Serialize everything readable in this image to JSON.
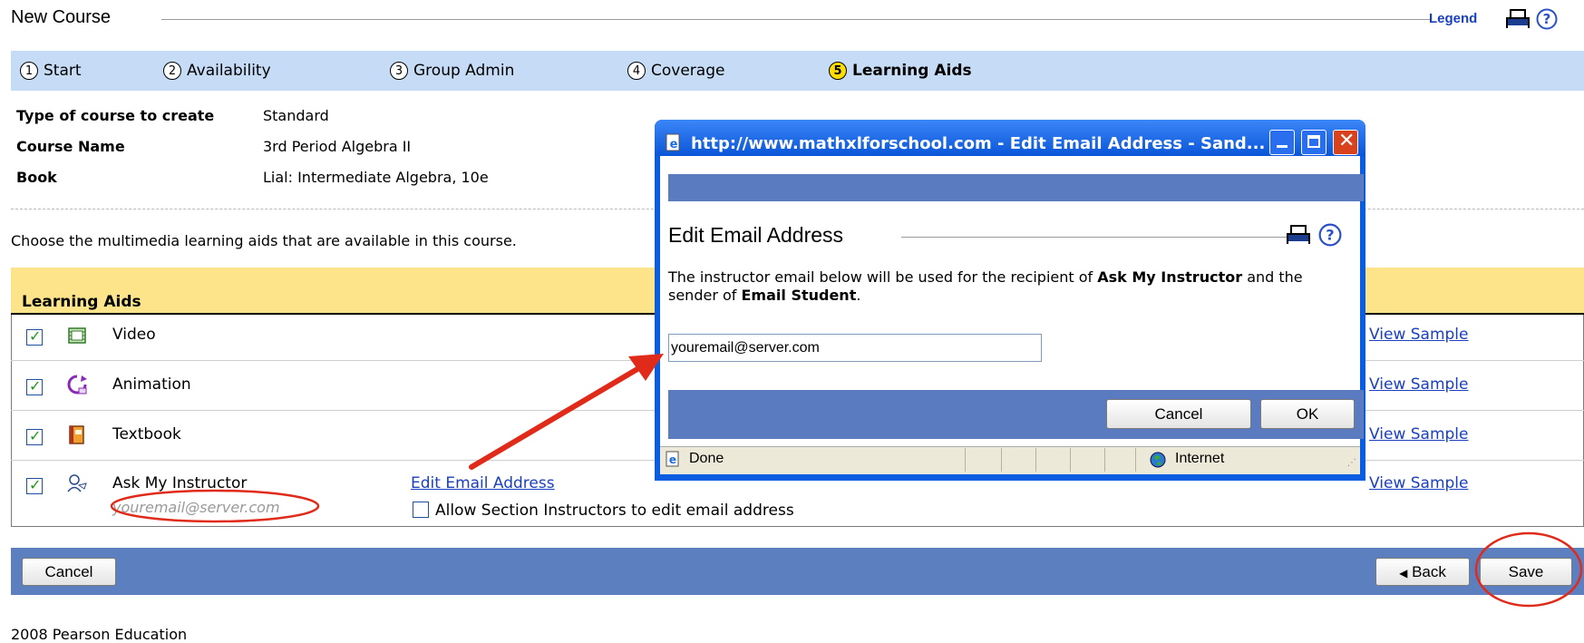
{
  "header": {
    "title": "New Course",
    "legend_label": "Legend"
  },
  "steps": [
    {
      "num": "1",
      "label": "Start",
      "active": false
    },
    {
      "num": "2",
      "label": "Availability",
      "active": false
    },
    {
      "num": "3",
      "label": "Group Admin",
      "active": false
    },
    {
      "num": "4",
      "label": "Coverage",
      "active": false
    },
    {
      "num": "5",
      "label": "Learning Aids",
      "active": true
    }
  ],
  "course_info": {
    "type_label": "Type of course to create",
    "type_value": "Standard",
    "name_label": "Course Name",
    "name_value": "3rd Period Algebra II",
    "book_label": "Book",
    "book_value": "Lial: Intermediate Algebra, 10e"
  },
  "instructions": "Choose the multimedia learning aids that are available in this course.",
  "aids": {
    "header": "Learning Aids",
    "view_sample_label": "View Sample",
    "rows": [
      {
        "label": "Video",
        "checked": true,
        "icon": "film-icon"
      },
      {
        "label": "Animation",
        "checked": true,
        "icon": "animation-icon"
      },
      {
        "label": "Textbook",
        "checked": true,
        "icon": "book-icon"
      },
      {
        "label": "Ask My Instructor",
        "checked": true,
        "icon": "instructor-icon",
        "email": "youremail@server.com",
        "edit_link": "Edit Email Address",
        "allow_label": "Allow Section Instructors to edit email address",
        "allow_checked": false
      }
    ]
  },
  "buttons": {
    "cancel": "Cancel",
    "back": "Back",
    "save": "Save"
  },
  "footer": "2008 Pearson Education",
  "popup": {
    "window_title": "http://www.mathxlforschool.com - Edit Email Address - Sand...",
    "heading": "Edit Email Address",
    "desc_pre": "The instructor email below will be used for the recipient of ",
    "desc_bold1": "Ask My Instructor",
    "desc_mid": " and the sender of ",
    "desc_bold2": "Email Student",
    "desc_end": ".",
    "email_value": "youremail@server.com",
    "cancel_label": "Cancel",
    "ok_label": "OK",
    "status_done": "Done",
    "status_zone": "Internet"
  },
  "colors": {
    "steps_bar": "#c6dbf5",
    "aids_header": "#fde48a",
    "bottom_bar": "#5b7fbf",
    "link": "#1a3fbf",
    "annotation": "#e02a1a"
  }
}
